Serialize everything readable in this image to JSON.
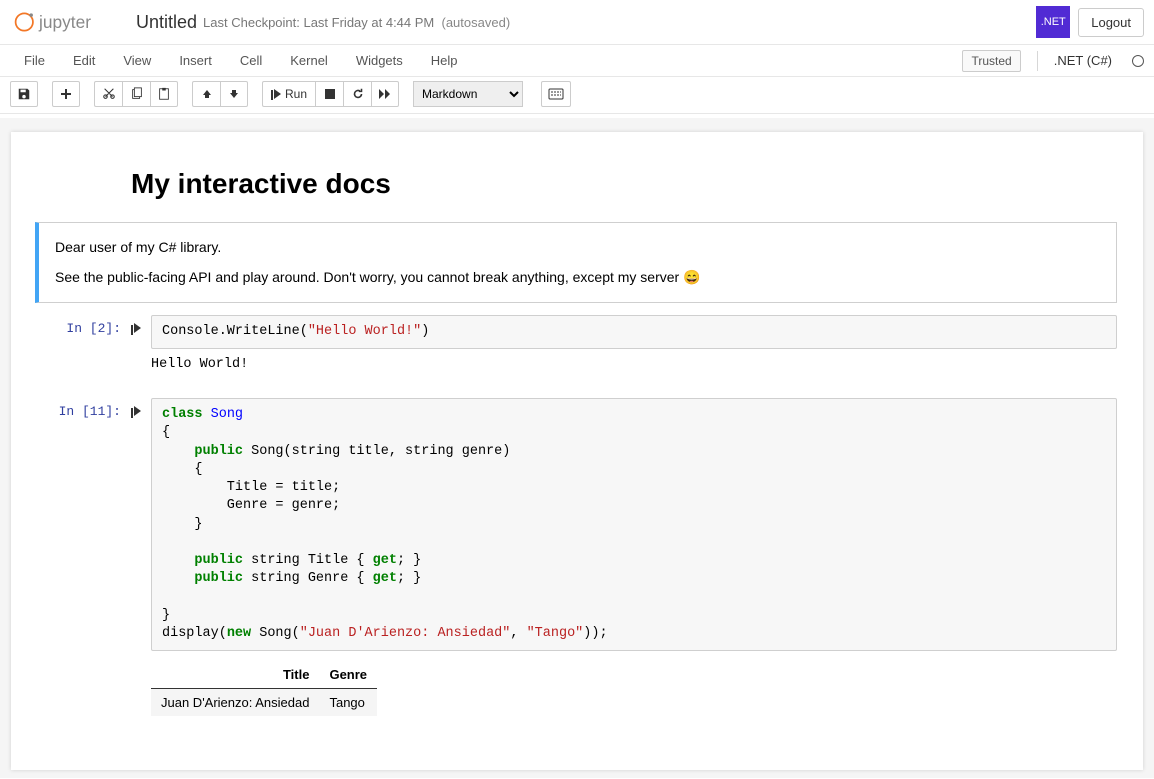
{
  "header": {
    "title": "Untitled",
    "checkpoint": "Last Checkpoint: Last Friday at 4:44 PM",
    "autosave": "(autosaved)",
    "logout": "Logout",
    "dotnet_badge": ".NET"
  },
  "menu": {
    "items": [
      "File",
      "Edit",
      "View",
      "Insert",
      "Cell",
      "Kernel",
      "Widgets",
      "Help"
    ],
    "trusted": "Trusted",
    "kernel": ".NET (C#)"
  },
  "toolbar": {
    "run_label": "Run",
    "cell_type": "Markdown"
  },
  "doc": {
    "heading": "My interactive docs",
    "para1": "Dear user of my C# library.",
    "para2_pre": "See the public-facing API and play around. Don't worry, you cannot break anything, except my server ",
    "para2_emoji": "😄",
    "cell2": {
      "prompt": "In [2]:",
      "code_prefix": "Console.WriteLine(",
      "code_str": "\"Hello World!\"",
      "code_suffix": ")",
      "output": "Hello World!"
    },
    "cell3": {
      "prompt": "In [11]:",
      "kw_class": "class",
      "type_song": "Song",
      "kw_public": "public",
      "sig_ctor": " Song(string title, string genre)",
      "body1": "        Title = title;",
      "body2": "        Genre = genre;",
      "prop_title_pre": " string Title { ",
      "prop_genre_pre": " string Genre { ",
      "kw_get": "get",
      "prop_post": "; }",
      "display_pre": "display(",
      "kw_new": "new",
      "display_mid": " Song(",
      "str_title": "\"Juan D'Arienzo: Ansiedad\"",
      "display_comma": ", ",
      "str_genre": "\"Tango\"",
      "display_post": "));",
      "table": {
        "h1": "Title",
        "h2": "Genre",
        "r1c1": "Juan D'Arienzo: Ansiedad",
        "r1c2": "Tango"
      }
    }
  }
}
